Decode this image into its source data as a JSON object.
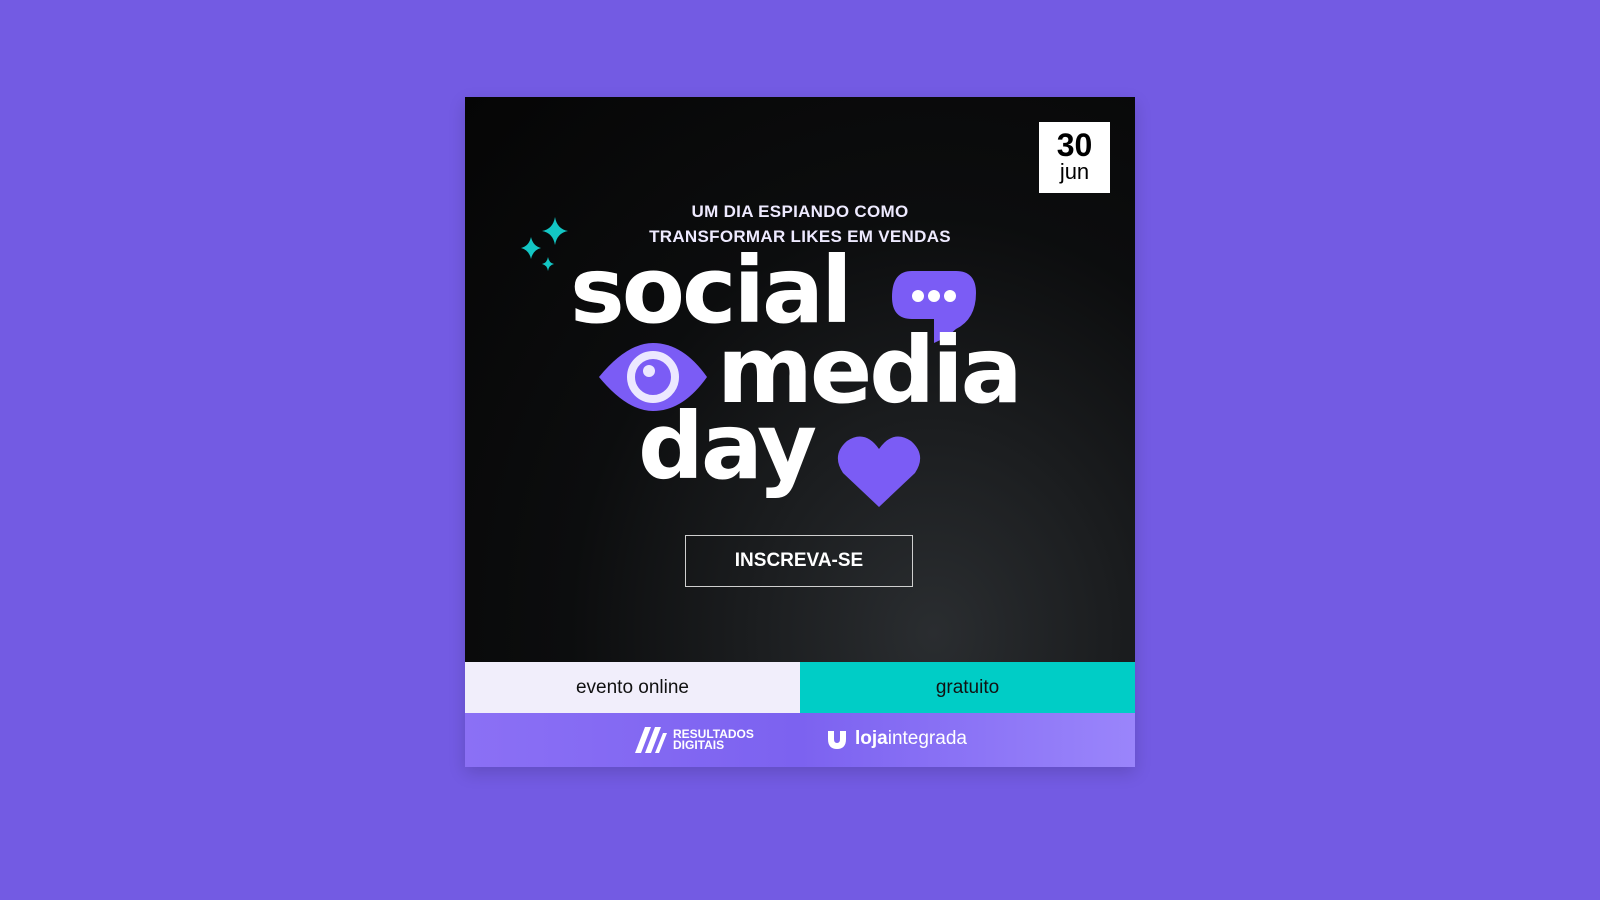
{
  "date": {
    "day": "30",
    "month": "jun"
  },
  "subtitle": {
    "line1": "UM DIA ESPIANDO COMO",
    "line2": "TRANSFORMAR LIKES EM VENDAS"
  },
  "title": {
    "word1": "social",
    "word2": "media",
    "word3": "day"
  },
  "cta": {
    "label": "INSCREVA-SE"
  },
  "info": {
    "left": "evento online",
    "right": "gratuito"
  },
  "sponsors": {
    "rd_line1": "RESULTADOS",
    "rd_line2": "DIGITAIS",
    "loja_bold": "loja",
    "loja_light": "integrada"
  },
  "colors": {
    "background": "#735be3",
    "accent_purple": "#7b5cf5",
    "accent_teal": "#00cdc6"
  }
}
